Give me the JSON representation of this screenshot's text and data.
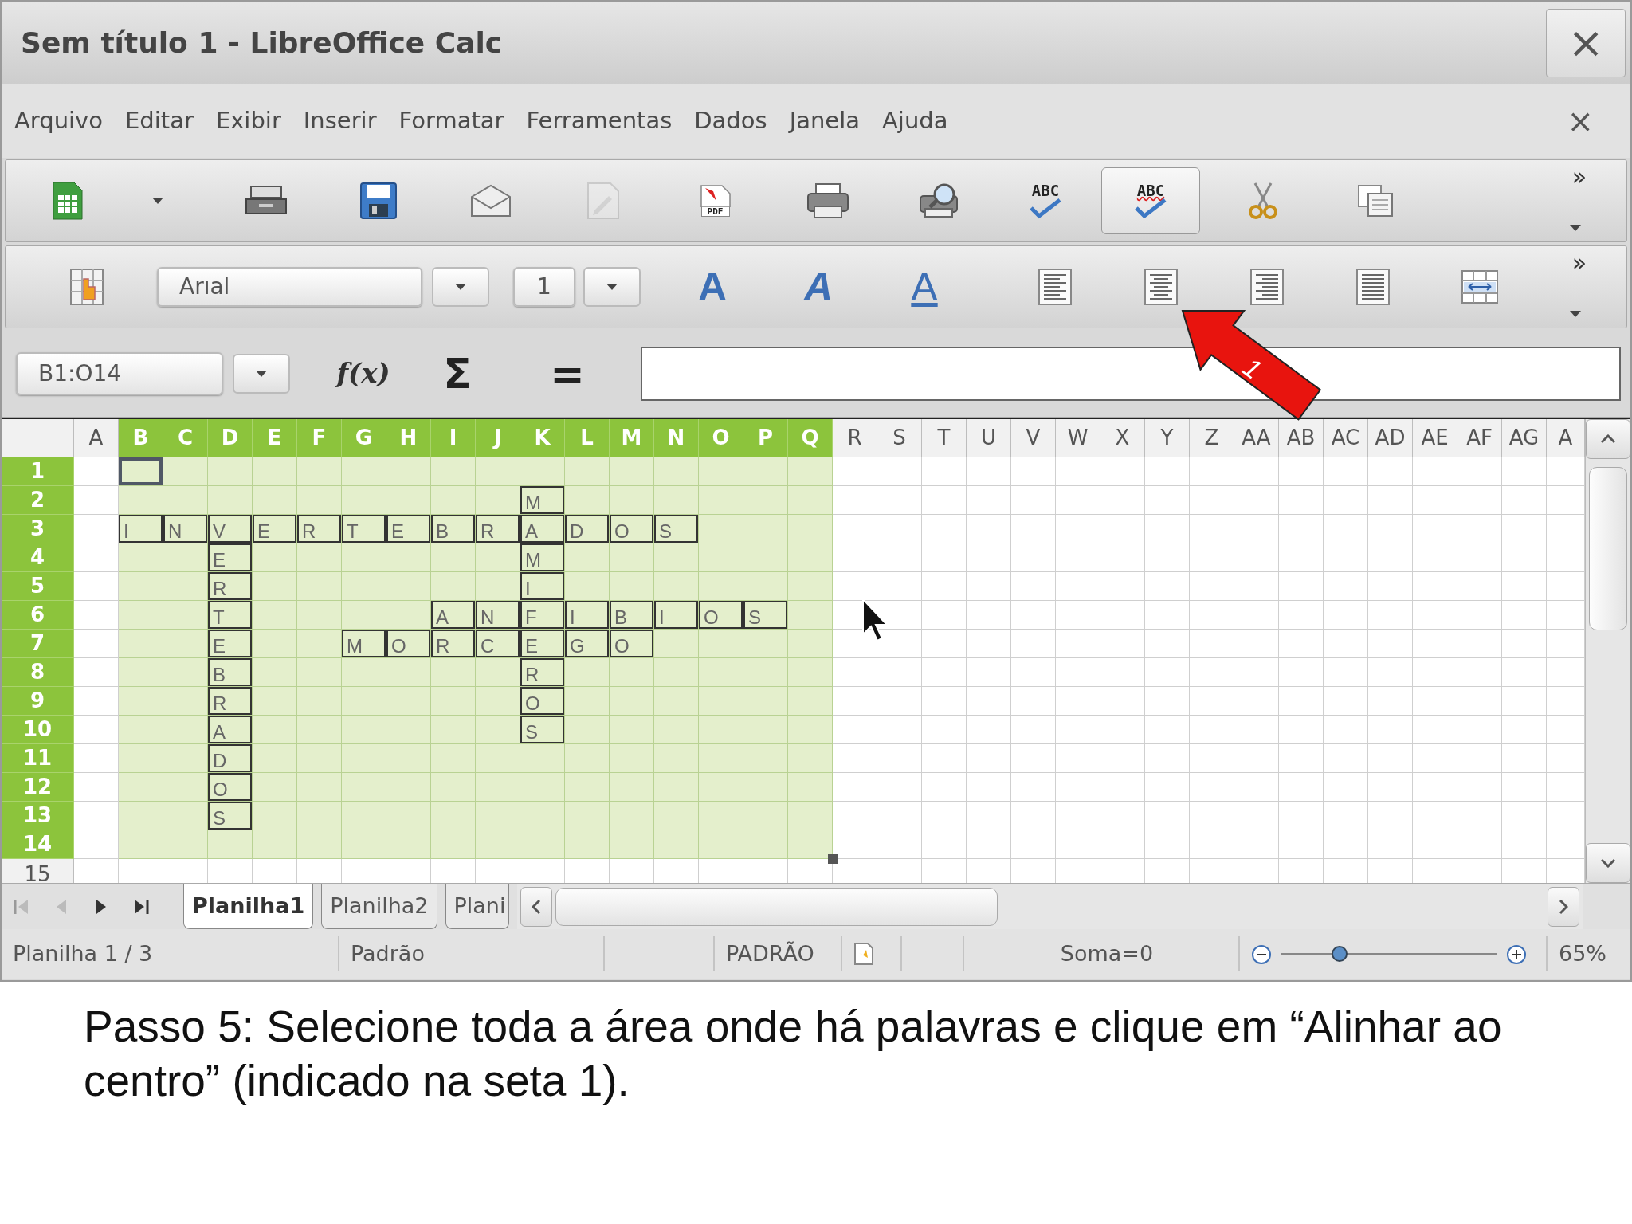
{
  "window": {
    "title": "Sem título 1 - LibreOffice Calc",
    "close": "×"
  },
  "menu": {
    "items": [
      "Arquivo",
      "Editar",
      "Exibir",
      "Inserir",
      "Formatar",
      "Ferramentas",
      "Dados",
      "Janela",
      "Ajuda"
    ],
    "close": "×"
  },
  "standard_toolbar": {
    "buttons": [
      {
        "pressed": false,
        "disabled": false
      },
      {
        "pressed": false,
        "disabled": false
      },
      {
        "pressed": false,
        "disabled": false
      },
      {
        "pressed": false,
        "disabled": false
      },
      {
        "pressed": false,
        "disabled": true
      },
      {
        "pressed": false,
        "disabled": false,
        "label": "PDF"
      },
      {
        "pressed": false,
        "disabled": false
      },
      {
        "pressed": false,
        "disabled": false
      },
      {
        "pressed": false,
        "disabled": false,
        "label": "ABC"
      },
      {
        "pressed": true,
        "disabled": false,
        "label": "ABC"
      },
      {
        "pressed": false,
        "disabled": false
      },
      {
        "pressed": false,
        "disabled": false
      }
    ],
    "overflow": "»"
  },
  "formatting_toolbar": {
    "font_name": "Arıal",
    "font_size": "1",
    "bold": "A",
    "italic": "A",
    "underline": "A",
    "overflow": "»"
  },
  "formula_bar": {
    "name_box": "B1:O14",
    "function_wizard": "f(x)",
    "sum": "Σ",
    "equals": "="
  },
  "sheet": {
    "columns": [
      {
        "label": "A",
        "selected": false
      },
      {
        "label": "B",
        "selected": true
      },
      {
        "label": "C",
        "selected": true
      },
      {
        "label": "D",
        "selected": true
      },
      {
        "label": "E",
        "selected": true
      },
      {
        "label": "F",
        "selected": true
      },
      {
        "label": "G",
        "selected": true
      },
      {
        "label": "H",
        "selected": true
      },
      {
        "label": "I",
        "selected": true
      },
      {
        "label": "J",
        "selected": true
      },
      {
        "label": "K",
        "selected": true
      },
      {
        "label": "L",
        "selected": true
      },
      {
        "label": "M",
        "selected": true
      },
      {
        "label": "N",
        "selected": true
      },
      {
        "label": "O",
        "selected": true
      },
      {
        "label": "P",
        "selected": true
      },
      {
        "label": "Q",
        "selected": true
      },
      {
        "label": "R",
        "selected": false
      },
      {
        "label": "S",
        "selected": false
      },
      {
        "label": "T",
        "selected": false
      },
      {
        "label": "U",
        "selected": false
      },
      {
        "label": "V",
        "selected": false
      },
      {
        "label": "W",
        "selected": false
      },
      {
        "label": "X",
        "selected": false
      },
      {
        "label": "Y",
        "selected": false
      },
      {
        "label": "Z",
        "selected": false
      },
      {
        "label": "AA",
        "selected": false
      },
      {
        "label": "AB",
        "selected": false
      },
      {
        "label": "AC",
        "selected": false
      },
      {
        "label": "AD",
        "selected": false
      },
      {
        "label": "AE",
        "selected": false
      },
      {
        "label": "AF",
        "selected": false
      },
      {
        "label": "AG",
        "selected": false
      },
      {
        "label": "A",
        "selected": false
      }
    ],
    "rows": [
      {
        "header": "1",
        "selected": true,
        "cells": [
          {
            "kind": "blank"
          },
          {
            "kind": "active"
          }
        ]
      },
      {
        "header": "2",
        "selected": true,
        "cells": [
          {
            "kind": "blank"
          },
          {
            "kind": "blank"
          },
          {
            "kind": "blank"
          },
          {
            "kind": "blank"
          },
          {
            "kind": "blank"
          },
          {
            "kind": "blank"
          },
          {
            "kind": "blank"
          },
          {
            "kind": "blank"
          },
          {
            "kind": "blank"
          },
          {
            "kind": "blank"
          },
          {
            "kind": "letter",
            "text": "M"
          }
        ]
      },
      {
        "header": "3",
        "selected": true,
        "cells": [
          {
            "kind": "blank"
          },
          {
            "kind": "letter",
            "text": "I"
          },
          {
            "kind": "letter",
            "text": "N"
          },
          {
            "kind": "letter",
            "text": "V"
          },
          {
            "kind": "letter",
            "text": "E"
          },
          {
            "kind": "letter",
            "text": "R"
          },
          {
            "kind": "letter",
            "text": "T"
          },
          {
            "kind": "letter",
            "text": "E"
          },
          {
            "kind": "letter",
            "text": "B"
          },
          {
            "kind": "letter",
            "text": "R"
          },
          {
            "kind": "letter",
            "text": "A"
          },
          {
            "kind": "letter",
            "text": "D"
          },
          {
            "kind": "letter",
            "text": "O"
          },
          {
            "kind": "letter",
            "text": "S"
          }
        ]
      },
      {
        "header": "4",
        "selected": true,
        "cells": [
          {
            "kind": "blank"
          },
          {
            "kind": "blank"
          },
          {
            "kind": "blank"
          },
          {
            "kind": "letter",
            "text": "E"
          },
          {
            "kind": "blank"
          },
          {
            "kind": "blank"
          },
          {
            "kind": "blank"
          },
          {
            "kind": "blank"
          },
          {
            "kind": "blank"
          },
          {
            "kind": "blank"
          },
          {
            "kind": "letter",
            "text": "M"
          }
        ]
      },
      {
        "header": "5",
        "selected": true,
        "cells": [
          {
            "kind": "blank"
          },
          {
            "kind": "blank"
          },
          {
            "kind": "blank"
          },
          {
            "kind": "letter",
            "text": "R"
          },
          {
            "kind": "blank"
          },
          {
            "kind": "blank"
          },
          {
            "kind": "blank"
          },
          {
            "kind": "blank"
          },
          {
            "kind": "blank"
          },
          {
            "kind": "blank"
          },
          {
            "kind": "letter",
            "text": "I"
          }
        ]
      },
      {
        "header": "6",
        "selected": true,
        "cells": [
          {
            "kind": "blank"
          },
          {
            "kind": "blank"
          },
          {
            "kind": "blank"
          },
          {
            "kind": "letter",
            "text": "T"
          },
          {
            "kind": "blank"
          },
          {
            "kind": "blank"
          },
          {
            "kind": "blank"
          },
          {
            "kind": "blank"
          },
          {
            "kind": "letter",
            "text": "A"
          },
          {
            "kind": "letter",
            "text": "N"
          },
          {
            "kind": "letter",
            "text": "F"
          },
          {
            "kind": "letter",
            "text": "I"
          },
          {
            "kind": "letter",
            "text": "B"
          },
          {
            "kind": "letter",
            "text": "I"
          },
          {
            "kind": "letter",
            "text": "O"
          },
          {
            "kind": "letter",
            "text": "S"
          }
        ]
      },
      {
        "header": "7",
        "selected": true,
        "cells": [
          {
            "kind": "blank"
          },
          {
            "kind": "blank"
          },
          {
            "kind": "blank"
          },
          {
            "kind": "letter",
            "text": "E"
          },
          {
            "kind": "blank"
          },
          {
            "kind": "blank"
          },
          {
            "kind": "letter",
            "text": "M"
          },
          {
            "kind": "letter",
            "text": "O"
          },
          {
            "kind": "letter",
            "text": "R"
          },
          {
            "kind": "letter",
            "text": "C"
          },
          {
            "kind": "letter",
            "text": "E"
          },
          {
            "kind": "letter",
            "text": "G"
          },
          {
            "kind": "letter",
            "text": "O"
          }
        ]
      },
      {
        "header": "8",
        "selected": true,
        "cells": [
          {
            "kind": "blank"
          },
          {
            "kind": "blank"
          },
          {
            "kind": "blank"
          },
          {
            "kind": "letter",
            "text": "B"
          },
          {
            "kind": "blank"
          },
          {
            "kind": "blank"
          },
          {
            "kind": "blank"
          },
          {
            "kind": "blank"
          },
          {
            "kind": "blank"
          },
          {
            "kind": "blank"
          },
          {
            "kind": "letter",
            "text": "R"
          }
        ]
      },
      {
        "header": "9",
        "selected": true,
        "cells": [
          {
            "kind": "blank"
          },
          {
            "kind": "blank"
          },
          {
            "kind": "blank"
          },
          {
            "kind": "letter",
            "text": "R"
          },
          {
            "kind": "blank"
          },
          {
            "kind": "blank"
          },
          {
            "kind": "blank"
          },
          {
            "kind": "blank"
          },
          {
            "kind": "blank"
          },
          {
            "kind": "blank"
          },
          {
            "kind": "letter",
            "text": "O"
          }
        ]
      },
      {
        "header": "10",
        "selected": true,
        "cells": [
          {
            "kind": "blank"
          },
          {
            "kind": "blank"
          },
          {
            "kind": "blank"
          },
          {
            "kind": "letter",
            "text": "A"
          },
          {
            "kind": "blank"
          },
          {
            "kind": "blank"
          },
          {
            "kind": "blank"
          },
          {
            "kind": "blank"
          },
          {
            "kind": "blank"
          },
          {
            "kind": "blank"
          },
          {
            "kind": "letter",
            "text": "S"
          }
        ]
      },
      {
        "header": "11",
        "selected": true,
        "cells": [
          {
            "kind": "blank"
          },
          {
            "kind": "blank"
          },
          {
            "kind": "blank"
          },
          {
            "kind": "letter",
            "text": "D"
          }
        ]
      },
      {
        "header": "12",
        "selected": true,
        "cells": [
          {
            "kind": "blank"
          },
          {
            "kind": "blank"
          },
          {
            "kind": "blank"
          },
          {
            "kind": "letter",
            "text": "O"
          }
        ]
      },
      {
        "header": "13",
        "selected": true,
        "cells": [
          {
            "kind": "blank"
          },
          {
            "kind": "blank"
          },
          {
            "kind": "blank"
          },
          {
            "kind": "letter",
            "text": "S"
          }
        ]
      },
      {
        "header": "14",
        "selected": true
      },
      {
        "header": "15",
        "selected": false
      }
    ]
  },
  "sheet_tabs": [
    {
      "label": "Planilha1",
      "selected": true
    },
    {
      "label": "Planilha2",
      "selected": false
    },
    {
      "label": "Plani",
      "selected": false
    }
  ],
  "status_bar": {
    "sheet": "Planilha 1 / 3",
    "page_style": "Padrão",
    "mode": "PADRÃO",
    "sum": "Soma=0",
    "zoom": {
      "level": 0.27
    },
    "zoom_percent": "65%"
  },
  "annotation": {
    "label": "1"
  },
  "caption": "Passo 5: Selecione toda a área onde há palavras e clique em “Alinhar ao centro” (indicado na seta 1)."
}
